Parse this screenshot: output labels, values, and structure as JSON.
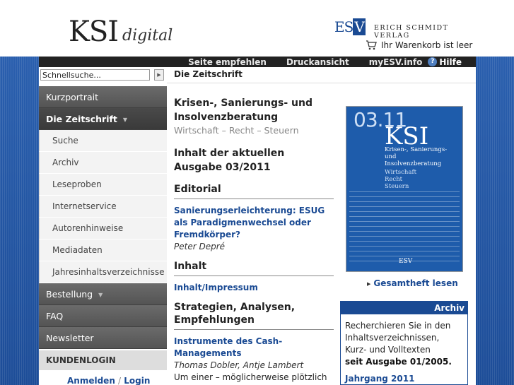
{
  "header": {
    "logo_main": "KSI",
    "logo_sub": "digital",
    "publisher_abbr_es": "ES",
    "publisher_abbr_v": "V",
    "publisher_name": "ERICH SCHMIDT VERLAG",
    "cart_text": "Ihr Warenkorb ist leer"
  },
  "topbar": {
    "recommend": "Seite empfehlen",
    "print": "Druckansicht",
    "my_esv": "myESV.info",
    "help": "Hilfe"
  },
  "search": {
    "placeholder": "Schnellsuche...",
    "value": "Schnellsuche...",
    "button": "▶"
  },
  "page_heading": "Die Zeitschrift",
  "sidebar": {
    "items": [
      {
        "label": "Kurzportrait"
      },
      {
        "label": "Die Zeitschrift"
      },
      {
        "label": "Suche"
      },
      {
        "label": "Archiv"
      },
      {
        "label": "Leseproben"
      },
      {
        "label": "Internetservice"
      },
      {
        "label": "Autorenhinweise"
      },
      {
        "label": "Mediadaten"
      },
      {
        "label": "Jahresinhaltsverzeichnisse"
      },
      {
        "label": "Bestellung"
      },
      {
        "label": "FAQ"
      },
      {
        "label": "Newsletter"
      }
    ],
    "kundenlogin": "KUNDENLOGIN",
    "login_anmelden": "Anmelden",
    "login_sep": "/",
    "login_login": "Login"
  },
  "main": {
    "journal_title": "Krisen-, Sanierungs- und Insolvenzberatung",
    "journal_subtitle": "Wirtschaft – Recht – Steuern",
    "issue_title": "Inhalt der aktuellen Ausgabe 03/2011",
    "editorial_heading": "Editorial",
    "editorial_article": "Sanierungserleichterung: ESUG als Paradigmenwechsel oder Fremdkörper?",
    "editorial_author": "Peter Depré",
    "inhalt_heading": "Inhalt",
    "inhalt_link": "Inhalt/Impressum",
    "strategien_heading": "Strategien, Analysen, Empfehlungen",
    "strategien_article": "Instrumente des Cash-Managements",
    "strategien_author": "Thomas Dobler, Antje Lambert",
    "strategien_text": "Um einer – möglicherweise plötzlich auftretenden – Unterversorgung mit"
  },
  "cover": {
    "issue": "03.11",
    "title": "KSI",
    "sub1": "Krisen-, Sanierungs-",
    "sub2": "und",
    "sub3": "Insolvenzberatung",
    "sub4": "Wirtschaft",
    "sub5": "Recht",
    "sub6": "Steuern",
    "publisher": "ESV",
    "link": "Gesamtheft lesen"
  },
  "archiv": {
    "heading": "Archiv",
    "text": "Recherchieren Sie in den Inhaltsverzeichnissen, Kurz- und Volltexten",
    "bold": "seit Ausgabe 01/2005.",
    "year": "Jahrgang 2011"
  },
  "colors": {
    "brand_blue": "#1a4a93",
    "nav_dark": "#545454",
    "link": "#1a4a93"
  }
}
